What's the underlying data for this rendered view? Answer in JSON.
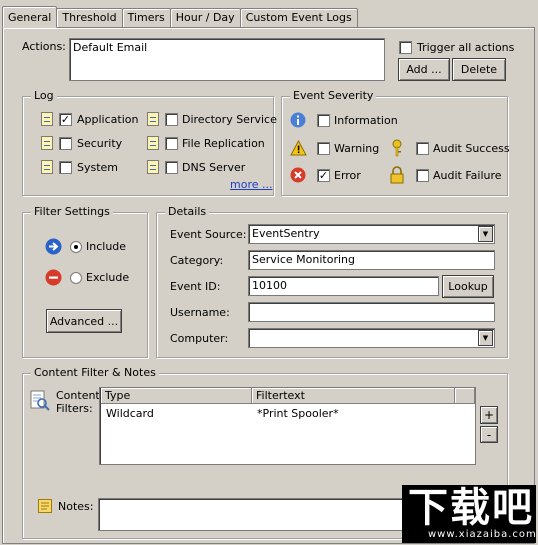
{
  "tabs": [
    "General",
    "Threshold",
    "Timers",
    "Hour / Day",
    "Custom Event Logs"
  ],
  "actions": {
    "label": "Actions:",
    "value": "Default Email",
    "trigger_all": "Trigger all actions",
    "add": "Add ...",
    "delete": "Delete"
  },
  "log": {
    "title": "Log",
    "items": [
      {
        "label": "Application",
        "checked": true
      },
      {
        "label": "Directory Service",
        "checked": false
      },
      {
        "label": "Security",
        "checked": false
      },
      {
        "label": "File Replication",
        "checked": false
      },
      {
        "label": "System",
        "checked": false
      },
      {
        "label": "DNS Server",
        "checked": false
      }
    ],
    "more": "more ..."
  },
  "severity": {
    "title": "Event Severity",
    "information": "Information",
    "warning": "Warning",
    "audit_success": "Audit Success",
    "error": "Error",
    "audit_failure": "Audit Failure",
    "error_checked": true
  },
  "filter": {
    "title": "Filter Settings",
    "include": "Include",
    "exclude": "Exclude",
    "selected": "Include",
    "advanced": "Advanced ..."
  },
  "details": {
    "title": "Details",
    "event_source_label": "Event Source:",
    "event_source": "EventSentry",
    "category_label": "Category:",
    "category": "Service Monitoring",
    "event_id_label": "Event ID:",
    "event_id": "10100",
    "lookup": "Lookup",
    "username_label": "Username:",
    "username": "",
    "computer_label": "Computer:",
    "computer": ""
  },
  "content": {
    "title": "Content Filter & Notes",
    "filters_label_1": "Content",
    "filters_label_2": "Filters:",
    "col_type": "Type",
    "col_filtertext": "Filtertext",
    "rows": [
      {
        "type": "Wildcard",
        "filtertext": "*Print Spooler*"
      }
    ],
    "plus": "+",
    "minus": "-",
    "notes_label": "Notes:",
    "notes": ""
  },
  "watermark": {
    "brand": "下载吧",
    "url": "www.xiazaiba.com"
  }
}
